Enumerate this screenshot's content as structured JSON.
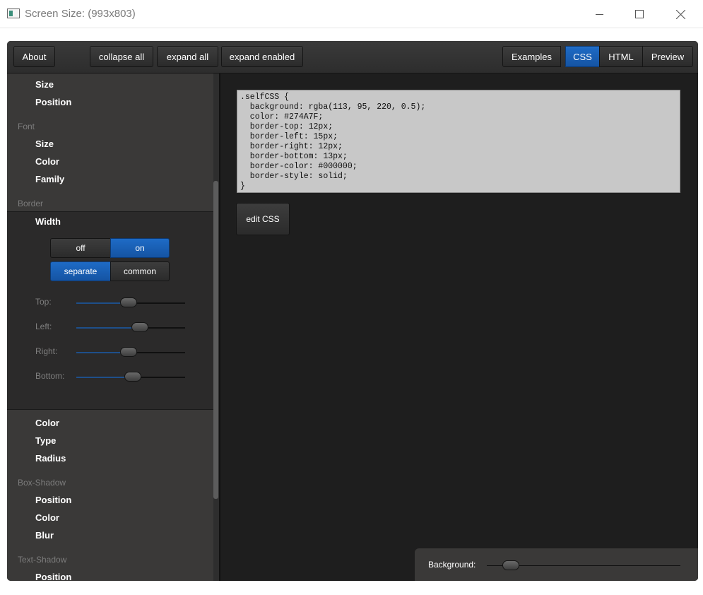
{
  "window": {
    "title": "Screen Size: (993x803)"
  },
  "toolbar": {
    "about": "About",
    "collapse_all": "collapse all",
    "expand_all": "expand all",
    "expand_enabled": "expand enabled",
    "view_tabs": [
      "Examples",
      "CSS",
      "HTML",
      "Preview"
    ],
    "active_tab": "CSS"
  },
  "sidebar": {
    "top_items": [
      "Size",
      "Position"
    ],
    "font": {
      "header": "Font",
      "items": [
        "Size",
        "Color",
        "Family"
      ]
    },
    "border": {
      "header": "Border",
      "width_label": "Width",
      "toggle_off": "off",
      "toggle_on": "on",
      "toggle_selected": "on",
      "mode_separate": "separate",
      "mode_common": "common",
      "mode_selected": "separate",
      "sliders": [
        {
          "label": "Top:",
          "value": 12
        },
        {
          "label": "Left:",
          "value": 15
        },
        {
          "label": "Right:",
          "value": 12
        },
        {
          "label": "Bottom:",
          "value": 13
        }
      ],
      "items": [
        "Color",
        "Type",
        "Radius"
      ]
    },
    "box_shadow": {
      "header": "Box-Shadow",
      "items": [
        "Position",
        "Color",
        "Blur"
      ]
    },
    "text_shadow": {
      "header": "Text-Shadow",
      "items": [
        "Position"
      ]
    }
  },
  "main": {
    "css_lines": [
      ".selfCSS {",
      "  background: rgba(113, 95, 220, 0.5);",
      "  color: #274A7F;",
      "  border-top: 12px;",
      "  border-left: 15px;",
      "  border-right: 12px;",
      "  border-bottom: 13px;",
      "  border-color: #000000;",
      "  border-style: solid;",
      "}"
    ],
    "edit_button": "edit CSS",
    "background_label": "Background:"
  },
  "colors": {
    "accent": "#1a5fb4",
    "panel": "#3a3938",
    "main_bg": "#1e1e1e",
    "code_bg": "#c8c8c8"
  }
}
